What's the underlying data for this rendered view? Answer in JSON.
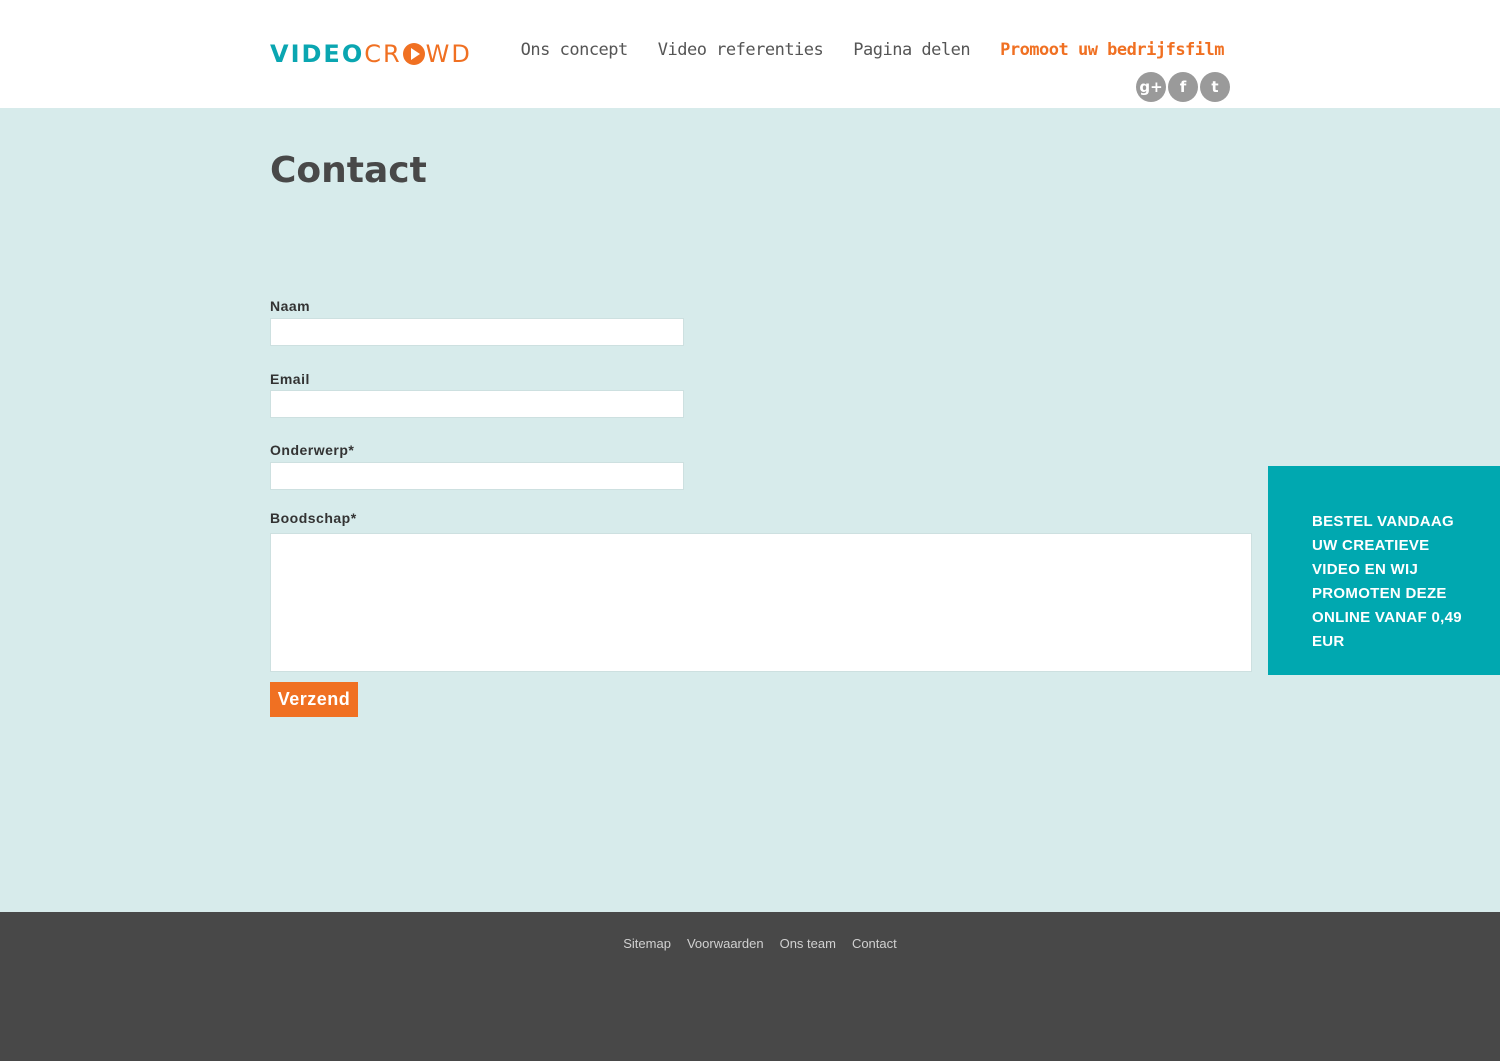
{
  "header": {
    "logo": {
      "part1": "VIDEO",
      "part2_a": "CR",
      "part2_b": "WD"
    },
    "nav": [
      {
        "label": "Ons concept"
      },
      {
        "label": "Video referenties"
      },
      {
        "label": "Pagina delen"
      },
      {
        "label": "Promoot uw bedrijfsfilm"
      }
    ],
    "social": [
      {
        "icon": "google-plus-icon",
        "glyph": "g+"
      },
      {
        "icon": "facebook-icon",
        "glyph": "f"
      },
      {
        "icon": "twitter-icon",
        "glyph": "t"
      }
    ]
  },
  "page": {
    "title": "Contact"
  },
  "form": {
    "name_label": "Naam",
    "name_value": "",
    "email_label": "Email",
    "email_value": "",
    "subject_label": "Onderwerp*",
    "subject_value": "",
    "message_label": "Boodschap*",
    "message_value": "",
    "submit_label": "Verzend"
  },
  "promo": {
    "text": "BESTEL VANDAAG UW CREATIEVE VIDEO EN WIJ PROMOTEN DEZE ONLINE VANAF 0,49 EUR"
  },
  "footer": {
    "links": [
      {
        "label": "Sitemap"
      },
      {
        "label": "Voorwaarden"
      },
      {
        "label": "Ons team"
      },
      {
        "label": "Contact"
      }
    ]
  },
  "colors": {
    "brand_teal": "#0aa6b1",
    "brand_orange": "#f07022",
    "page_bg": "#d7ebeb",
    "footer_bg": "#484848",
    "promo_bg": "#00a8b0"
  }
}
